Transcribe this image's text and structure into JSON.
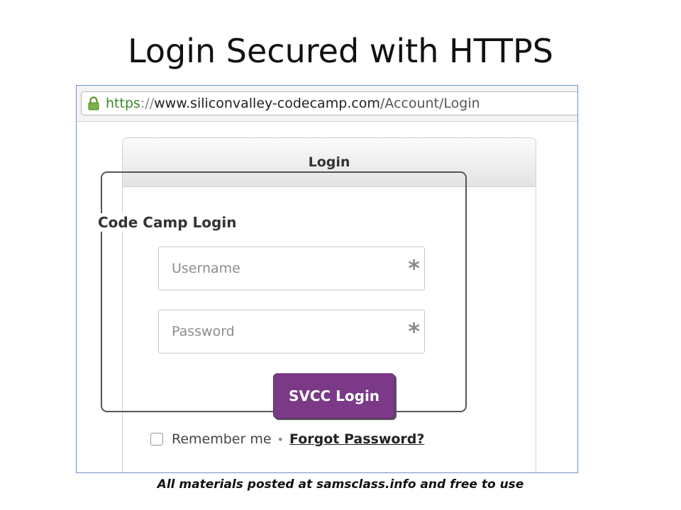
{
  "slide": {
    "title": "Login Secured with HTTPS",
    "footer": "All materials posted at samsclass.info and free to use"
  },
  "browser": {
    "url_scheme": "https",
    "url_separator": "://",
    "url_host": "www.siliconvalley-codecamp.com",
    "url_path": "/Account/Login",
    "lock_icon": "lock-icon",
    "secure_color": "#3a8a2a"
  },
  "login_panel": {
    "header": "Login",
    "legend": "Code Camp Login",
    "username_placeholder": "Username",
    "password_placeholder": "Password",
    "required_marker": "*",
    "submit_label": "SVCC Login",
    "submit_color": "#7b3987",
    "remember_label": "Remember me",
    "separator": "•",
    "forgot_label": "Forgot Password?"
  }
}
